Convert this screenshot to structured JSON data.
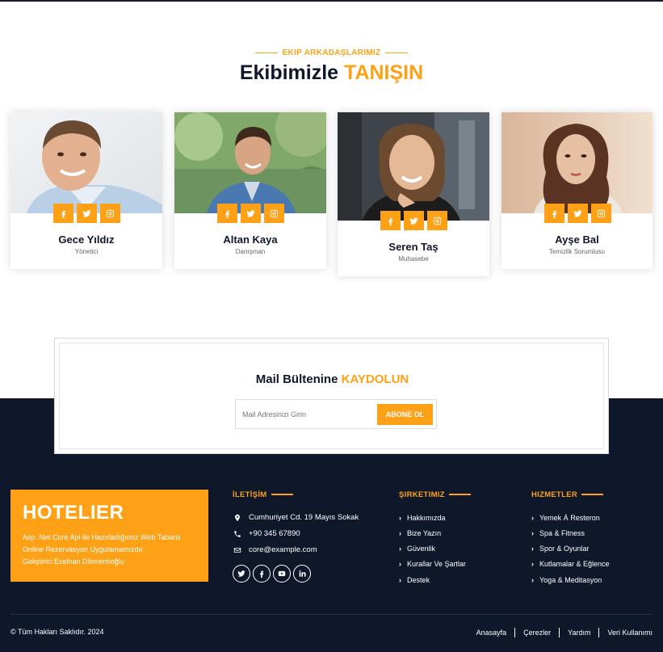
{
  "team": {
    "subheading": "EKIP ARKADAŞLARIMIZ",
    "heading_main": "Ekibimizle",
    "heading_accent": "TANIŞIN",
    "members": [
      {
        "name": "Gece Yıldız",
        "role": "Yönetici"
      },
      {
        "name": "Altan Kaya",
        "role": "Danışman"
      },
      {
        "name": "Seren Taş",
        "role": "Muhasebe"
      },
      {
        "name": "Ayşe Bal",
        "role": "Temizlik Sorumlusu"
      }
    ],
    "social_icons": [
      "facebook-icon",
      "twitter-icon",
      "instagram-icon"
    ]
  },
  "newsletter": {
    "title_main": "Mail Bültenine",
    "title_accent": "KAYDOLUN",
    "input_placeholder": "Mail Adresinizi Girin",
    "button_label": "ABONE OL"
  },
  "footer": {
    "brand": {
      "title": "HOTELIER",
      "description": "Asp .Net Core Api ile Hazırladığımız Web Tabanlı Online Rezervasyon Uygulamamızdır. Geliştirici:Ezelhan Dikmenlioğlu"
    },
    "contact": {
      "title": "İLETİŞİM",
      "address": "Cumhuriyet Cd. 19 Mayıs Sokak",
      "phone": "+90 345 67890",
      "email": "core@example.com",
      "social_icons": [
        "twitter-icon",
        "facebook-icon",
        "youtube-icon",
        "linkedin-icon"
      ]
    },
    "company": {
      "title": "ŞIRKETIMIZ",
      "links": [
        "Hakkımızda",
        "Bize Yazın",
        "Güvenlik",
        "Kurallar Ve Şartlar",
        "Destek"
      ]
    },
    "services": {
      "title": "HIZMETLER",
      "links": [
        "Yemek Á Resteron",
        "Spa & Fitness",
        "Spor & Oyunlar",
        "Kutlamalar & Eğlence",
        "Yoga & Meditasyon"
      ]
    },
    "copyright": "© Tüm Hakları Saklıdır. 2024",
    "bottom_links": [
      "Anasayfa",
      "Çerezler",
      "Yardım",
      "Veri Kullanımı"
    ]
  },
  "colors": {
    "accent": "#fea116",
    "dark": "#0f172b",
    "white": "#ffffff"
  }
}
